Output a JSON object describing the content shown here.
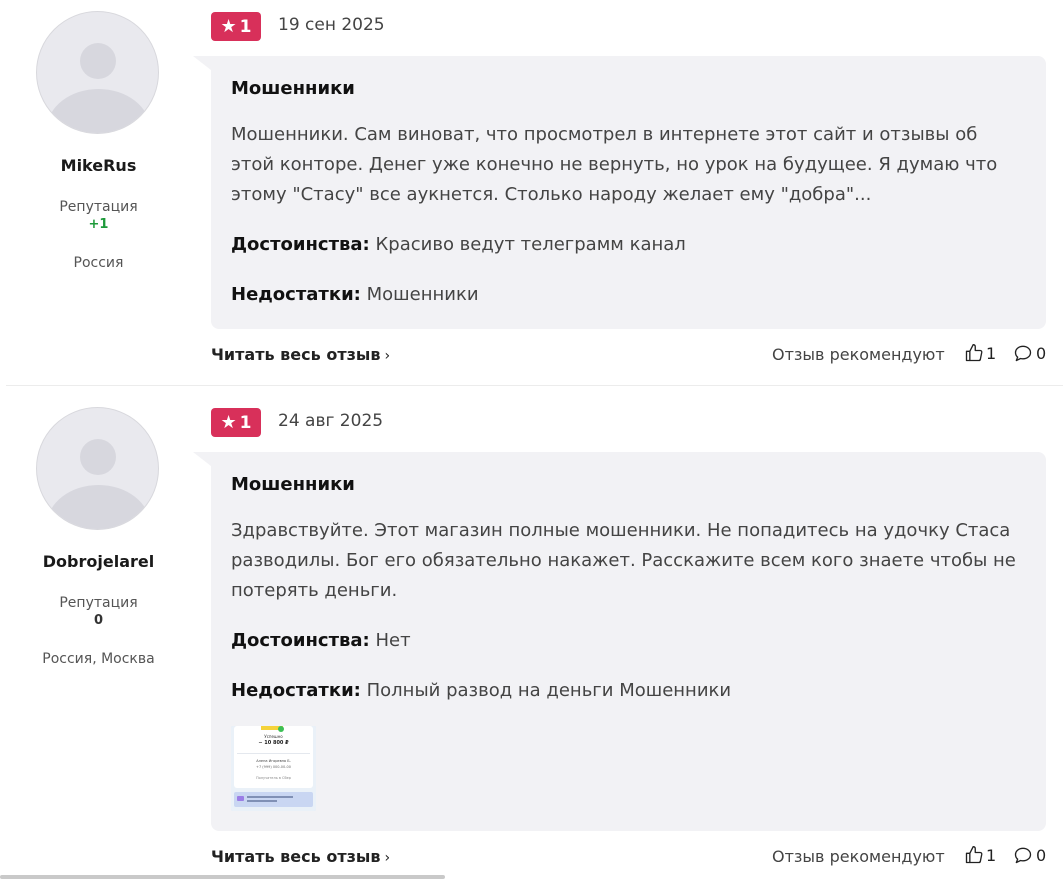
{
  "reviews": [
    {
      "author": {
        "name": "MikeRus",
        "reputation_label": "Репутация",
        "reputation_value": "+1",
        "location": "Россия"
      },
      "rating": "1",
      "date": "19 сен 2025",
      "title": "Мошенники",
      "text": "Мошенники. Сам виноват, что просмотрел в интернете этот сайт и отзывы об этой конторе. Денег уже конечно не вернуть, но урок на будущее. Я думаю что этому \"Стасу\" все аукнется. Столько народу желает ему \"добра\"...",
      "pros_label": "Достоинства:",
      "pros": "Красиво ведут телеграмм канал",
      "cons_label": "Недостатки:",
      "cons": "Мошенники",
      "read_more": "Читать весь отзыв",
      "recommend_label": "Отзыв рекомендуют",
      "likes": "1",
      "comments": "0"
    },
    {
      "author": {
        "name": "Dobrojelarel",
        "reputation_label": "Репутация",
        "reputation_value": "0",
        "location": "Россия, Москва"
      },
      "rating": "1",
      "date": "24 авг 2025",
      "title": "Мошенники",
      "text": "Здравствуйте. Этот магазин полные мошенники. Не попадитесь на удочку Стаса разводилы. Бог его обязательно накажет. Расскажите всем кого знаете чтобы не потерять деньги.",
      "pros_label": "Достоинства:",
      "pros": "Нет",
      "cons_label": "Недостатки:",
      "cons": "Полный развод на деньги Мошенники",
      "attachment": {
        "label": "Успешно",
        "amount": "− 10 800 ₽",
        "recipient": "Алена Игоревна Б.",
        "phone": "+7 (999) 000-00-00",
        "note": "Получатель в Сбер"
      },
      "read_more": "Читать весь отзыв",
      "recommend_label": "Отзыв рекомендуют",
      "likes": "1",
      "comments": "0"
    }
  ],
  "colors": {
    "rating_badge": "#d8305a",
    "card_bg": "#f2f2f5",
    "positive_rep": "#1d9a3a"
  }
}
